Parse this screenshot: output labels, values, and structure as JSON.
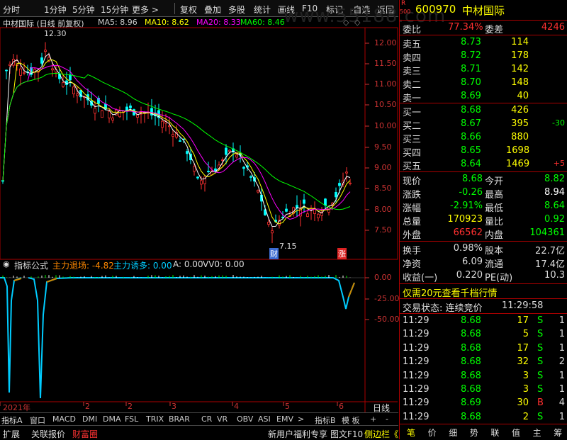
{
  "toolbar": {
    "items": [
      "分时",
      "1分钟",
      "5分钟",
      "15分钟",
      "更多 >",
      "复权",
      "叠加",
      "多股",
      "统计",
      "画线",
      "F10",
      "标记",
      "-自选",
      "返回"
    ]
  },
  "colors": {
    "up": "#ff3030",
    "down": "#00ffff",
    "flat": "#ffffff",
    "ma5": "#ffffff",
    "ma10": "#ffff00",
    "ma20": "#ff00ff",
    "ma60": "#00ff00",
    "indicator": "#00ccff"
  },
  "chart_legend": {
    "name": "中材国际 (日线 前复权)",
    "ma5": "MA5: 8.96",
    "ma10": "MA10: 8.62",
    "ma20": "MA20: 8.33",
    "ma60": "MA60: 8.46",
    "watermark": "www.55188.com"
  },
  "price_axis": [
    "12.00",
    "11.50",
    "11.00",
    "10.50",
    "10.00",
    "9.50",
    "9.00",
    "8.50",
    "8.00",
    "7.50"
  ],
  "annotations": {
    "high": "12.30",
    "low": "7.15",
    "cai": "财",
    "zhang": "涨"
  },
  "indicator": {
    "name": "指标公式",
    "zhuli_exit": "主力退场: -4.82",
    "zhuli_lure": "主力诱多: 0.00",
    "a": "A: 0.00",
    "vv": "VV0: 0.00",
    "axis": [
      "0.00",
      "-25.00",
      "-50.00"
    ]
  },
  "time_axis": {
    "year": "2021年",
    "months": [
      "2",
      "3",
      "4",
      "5",
      "6"
    ],
    "mode": "日线"
  },
  "indicator_tabs": [
    "指标A",
    "窗口",
    "MACD",
    "DMI",
    "DMA",
    "FSL",
    "TRIX",
    "BRAR",
    "CR",
    "VR",
    "OBV",
    "ASI",
    "EMV"
  ],
  "indicator_tabs_right": [
    "指标B",
    "模 板",
    "+",
    "-"
  ],
  "bottom_bar": [
    "扩展",
    "关联报价",
    "财富圈"
  ],
  "bottom_bar_right": [
    "新用户福利专享",
    "图文F10",
    "侧边栏《"
  ],
  "stock": {
    "code": "600970",
    "name": "中材国际",
    "r_label": "R",
    "index_label": "500"
  },
  "weibi": {
    "label1": "委比",
    "val1": "77.34%",
    "label2": "委差",
    "val2": "4246"
  },
  "sell_orders": [
    {
      "label": "卖五",
      "price": "8.73",
      "vol": "114"
    },
    {
      "label": "卖四",
      "price": "8.72",
      "vol": "178"
    },
    {
      "label": "卖三",
      "price": "8.71",
      "vol": "142"
    },
    {
      "label": "卖二",
      "price": "8.70",
      "vol": "148"
    },
    {
      "label": "卖一",
      "price": "8.69",
      "vol": "40"
    }
  ],
  "buy_orders": [
    {
      "label": "买一",
      "price": "8.68",
      "vol": "426",
      "chg": ""
    },
    {
      "label": "买二",
      "price": "8.67",
      "vol": "395",
      "chg": "-30"
    },
    {
      "label": "买三",
      "price": "8.66",
      "vol": "880",
      "chg": ""
    },
    {
      "label": "买四",
      "price": "8.65",
      "vol": "1698",
      "chg": ""
    },
    {
      "label": "买五",
      "price": "8.64",
      "vol": "1469",
      "chg": "+5"
    }
  ],
  "quote": [
    {
      "l1": "现价",
      "v1": "8.68",
      "c1": "#00ff00",
      "l2": "今开",
      "v2": "8.82",
      "c2": "#00ff00"
    },
    {
      "l1": "涨跌",
      "v1": "-0.26",
      "c1": "#00ff00",
      "l2": "最高",
      "v2": "8.94",
      "c2": "#ffffff"
    },
    {
      "l1": "涨幅",
      "v1": "-2.91%",
      "c1": "#00ff00",
      "l2": "最低",
      "v2": "8.64",
      "c2": "#00ff00"
    },
    {
      "l1": "总量",
      "v1": "170923",
      "c1": "#ffff00",
      "l2": "量比",
      "v2": "0.92",
      "c2": "#00ff00"
    },
    {
      "l1": "外盘",
      "v1": "66562",
      "c1": "#ff3030",
      "l2": "内盘",
      "v2": "104361",
      "c2": "#00ff00"
    }
  ],
  "fund": [
    {
      "l1": "换手",
      "v1": "0.98%",
      "l2": "股本",
      "v2": "22.7亿"
    },
    {
      "l1": "净资",
      "v1": "6.09",
      "l2": "流通",
      "v2": "17.4亿"
    },
    {
      "l1": "收益(一)",
      "v1": "0.220",
      "l2": "PE(动)",
      "v2": "10.3"
    }
  ],
  "promo": "仅需20元查看千档行情",
  "status": {
    "label": "交易状态: 连续竞价",
    "time": "11:29:58"
  },
  "trades": [
    {
      "t": "11:29",
      "p": "8.68",
      "v": "17",
      "s": "S",
      "n": "1"
    },
    {
      "t": "11:29",
      "p": "8.68",
      "v": "5",
      "s": "S",
      "n": "1"
    },
    {
      "t": "11:29",
      "p": "8.68",
      "v": "17",
      "s": "S",
      "n": "1"
    },
    {
      "t": "11:29",
      "p": "8.68",
      "v": "32",
      "s": "S",
      "n": "2"
    },
    {
      "t": "11:29",
      "p": "8.68",
      "v": "3",
      "s": "S",
      "n": "1"
    },
    {
      "t": "11:29",
      "p": "8.68",
      "v": "3",
      "s": "S",
      "n": "1"
    },
    {
      "t": "11:29",
      "p": "8.69",
      "v": "30",
      "s": "B",
      "n": "4"
    },
    {
      "t": "11:29",
      "p": "8.68",
      "v": "2",
      "s": "S",
      "n": "1"
    }
  ],
  "right_tabs": [
    "笔",
    "价",
    "细",
    "势",
    "联",
    "值",
    "主",
    "筹"
  ]
}
